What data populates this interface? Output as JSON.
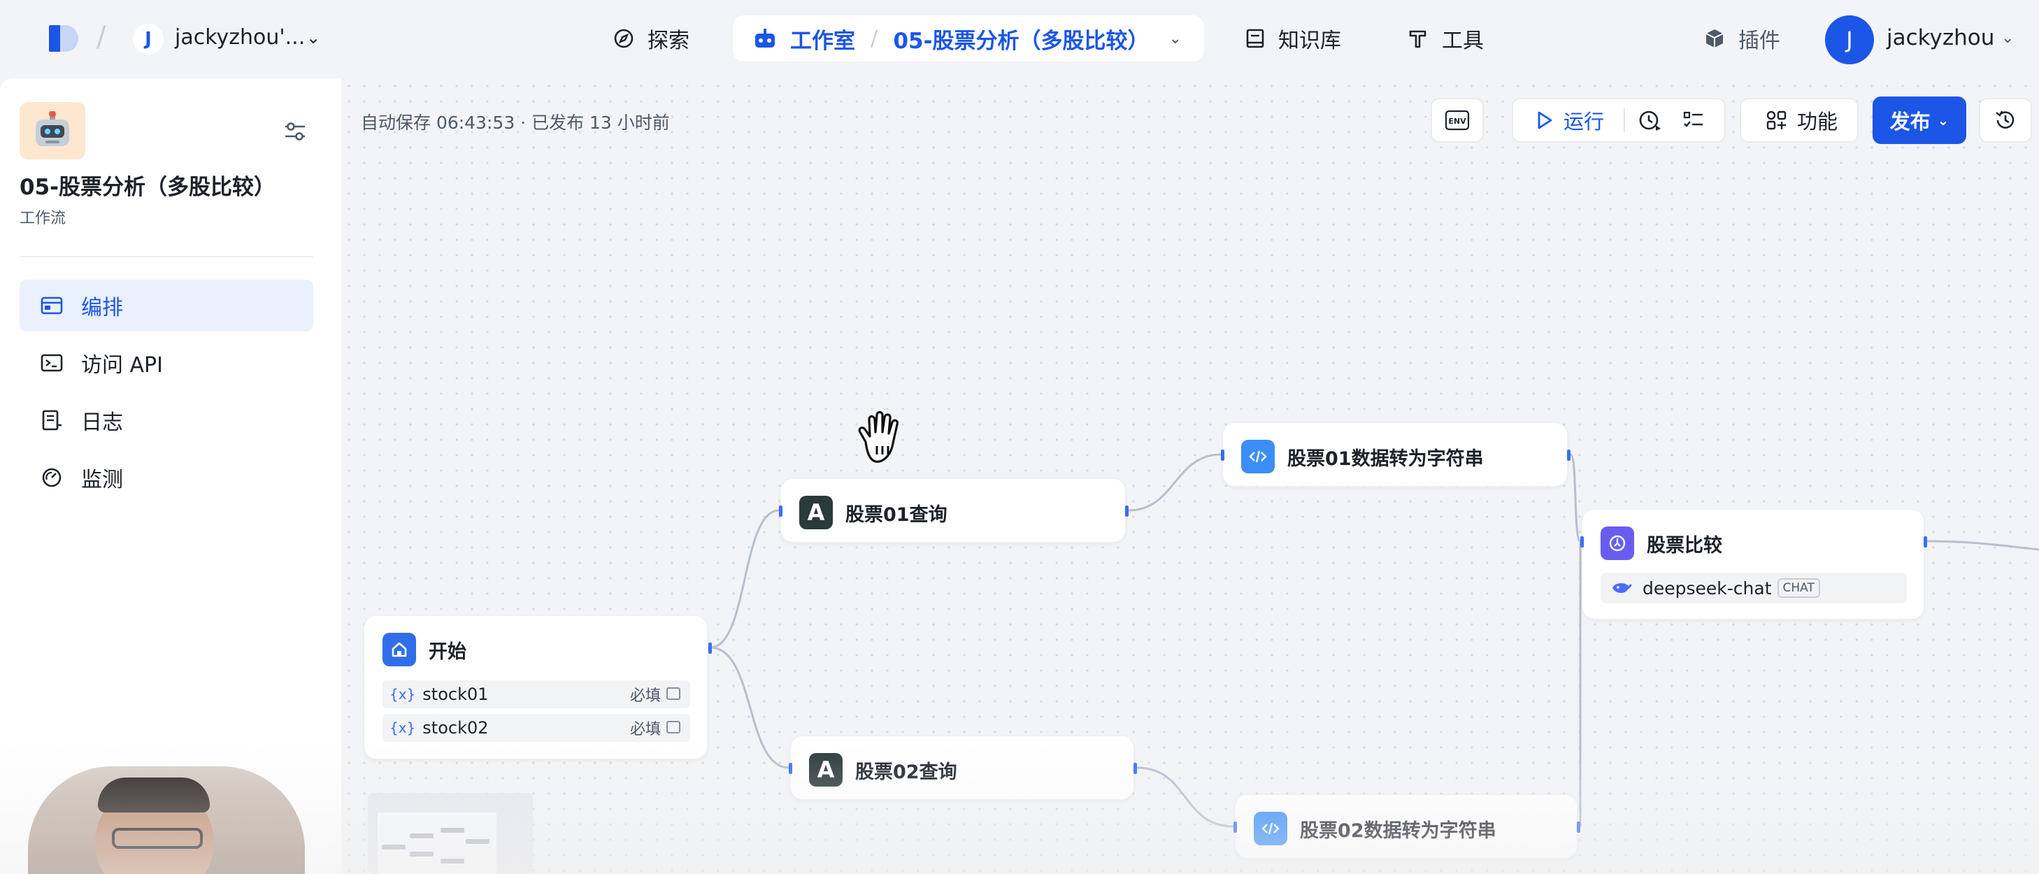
{
  "topnav": {
    "workspace_initial": "J",
    "workspace_name": "jackyzhou'...",
    "explore": "探索",
    "studio": "工作室",
    "project": "05-股票分析（多股比较）",
    "knowledge": "知识库",
    "tools": "工具",
    "plugins": "插件",
    "user_initial": "J",
    "user_name": "jackyzhou"
  },
  "sidebar": {
    "app_title": "05-股票分析（多股比较）",
    "app_type": "工作流",
    "items": [
      {
        "label": "编排",
        "icon": "layout-icon",
        "active": true
      },
      {
        "label": "访问 API",
        "icon": "terminal-icon",
        "active": false
      },
      {
        "label": "日志",
        "icon": "log-icon",
        "active": false
      },
      {
        "label": "监测",
        "icon": "gauge-icon",
        "active": false
      }
    ]
  },
  "toolbar": {
    "autosave": "自动保存 06:43:53 · 已发布 13 小时前",
    "env": "ENV",
    "run": "运行",
    "features": "功能",
    "publish": "发布"
  },
  "nodes": {
    "start": {
      "title": "开始",
      "vars": [
        {
          "name": "stock01",
          "required": "必填"
        },
        {
          "name": "stock02",
          "required": "必填"
        }
      ]
    },
    "q1": {
      "title": "股票01查询",
      "icon_letter": "A"
    },
    "q2": {
      "title": "股票02查询",
      "icon_letter": "A"
    },
    "s1": {
      "title": "股票01数据转为字符串"
    },
    "s2": {
      "title": "股票02数据转为字符串"
    },
    "compare": {
      "title": "股票比较",
      "model": "deepseek-chat",
      "model_tag": "CHAT"
    }
  },
  "colors": {
    "accent": "#1c56e6",
    "background": "#f2f4f7",
    "port": "#3a6ff0"
  }
}
